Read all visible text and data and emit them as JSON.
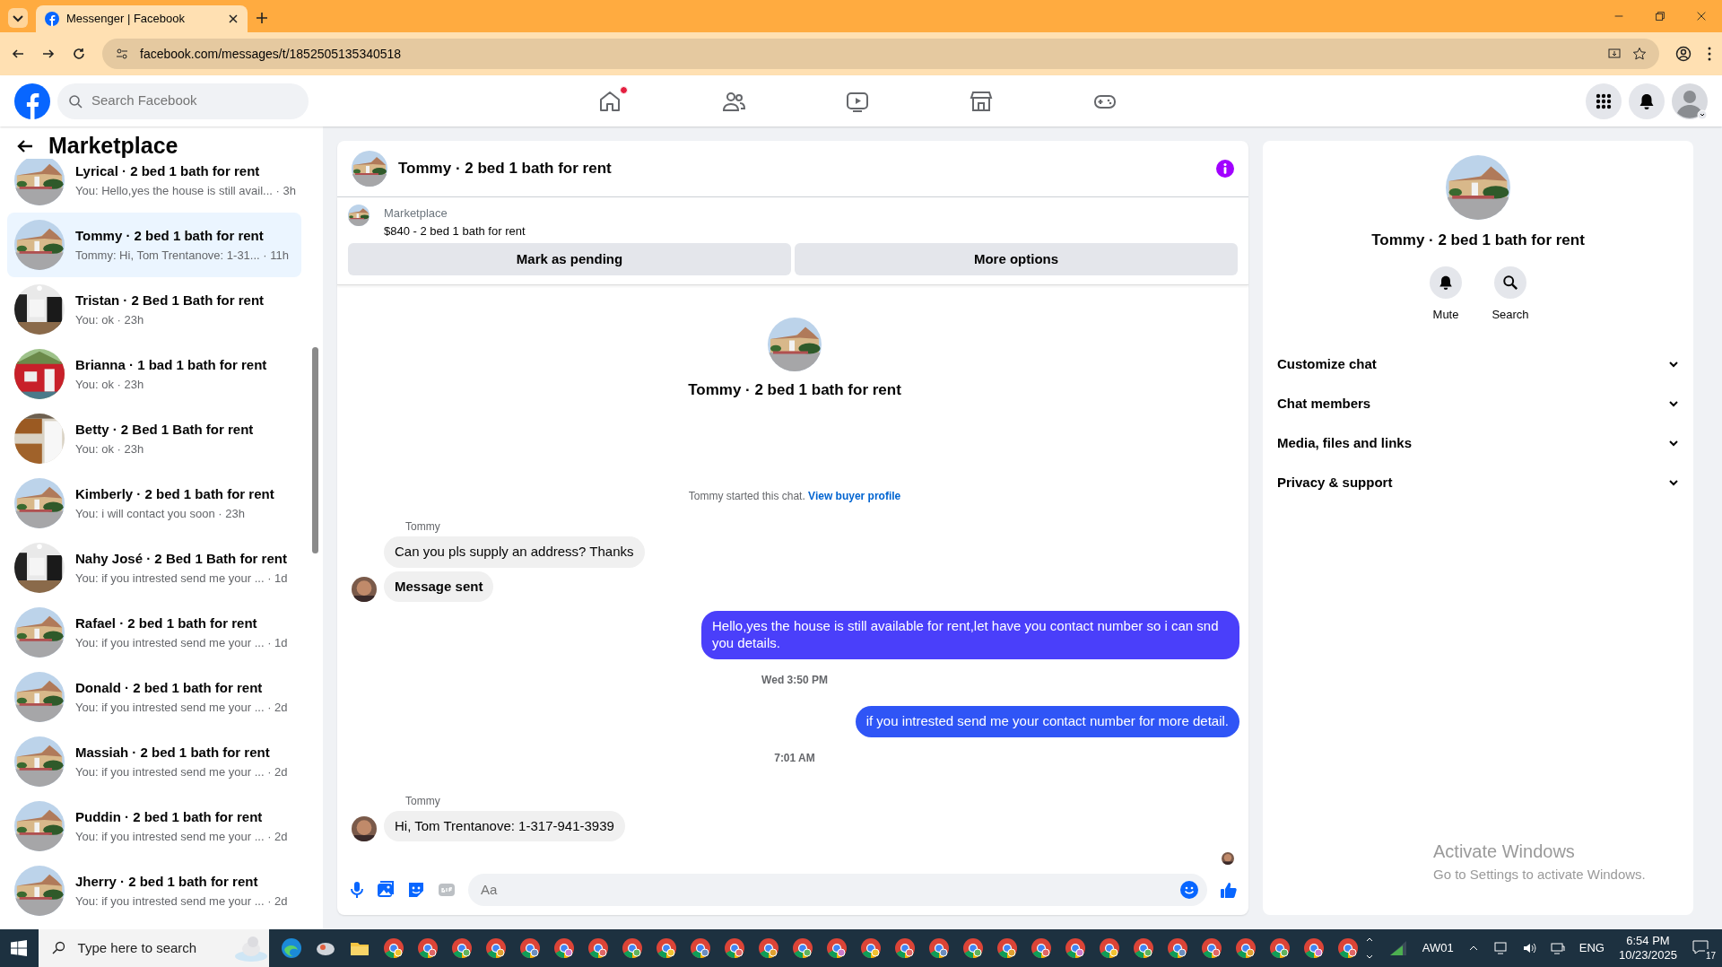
{
  "browser": {
    "tab_title": "Messenger | Facebook",
    "url": "facebook.com/messages/t/1852505135340518"
  },
  "facebook_header": {
    "search_placeholder": "Search Facebook",
    "home_notification": true
  },
  "sidebar": {
    "title": "Marketplace",
    "conversations": [
      {
        "name": "Lyrical · 2 bed 1 bath for rent",
        "preview": "You: Hello,yes the house is still avail... · 3h",
        "selected": false
      },
      {
        "name": "Tommy · 2 bed 1 bath for rent",
        "preview": "Tommy: Hi, Tom Trentanove: 1-31...  · 11h",
        "selected": true
      },
      {
        "name": "Tristan · 2 Bed 1 Bath for rent",
        "preview": "You: ok · 23h",
        "selected": false
      },
      {
        "name": "Brianna · 1 bad 1 bath for rent",
        "preview": "You: ok · 23h",
        "selected": false
      },
      {
        "name": "Betty · 2 Bed 1 Bath for rent",
        "preview": "You: ok · 23h",
        "selected": false
      },
      {
        "name": "Kimberly · 2 bed 1 bath for rent",
        "preview": "You: i will contact you soon · 23h",
        "selected": false
      },
      {
        "name": "Nahy José · 2 Bed 1 Bath for rent",
        "preview": "You: if you intrested send me your ... · 1d",
        "selected": false
      },
      {
        "name": "Rafael · 2 bed 1 bath for rent",
        "preview": "You: if you intrested send me your ... · 1d",
        "selected": false
      },
      {
        "name": "Donald · 2 bed 1 bath for rent",
        "preview": "You: if you intrested send me your ... · 2d",
        "selected": false
      },
      {
        "name": "Massiah · 2 bed 1 bath for rent",
        "preview": "You: if you intrested send me your ... · 2d",
        "selected": false
      },
      {
        "name": "Puddin · 2 bed 1 bath for rent",
        "preview": "You: if you intrested send me your ... · 2d",
        "selected": false
      },
      {
        "name": "Jherry · 2 bed 1 bath for rent",
        "preview": "You: if you intrested send me your ... · 2d",
        "selected": false
      }
    ]
  },
  "chat": {
    "title": "Tommy · 2 bed 1 bath for rent",
    "listing": {
      "label": "Marketplace",
      "title": "$840 - 2 bed 1 bath for rent"
    },
    "buttons": [
      "Mark as pending",
      "More options"
    ],
    "intro_name": "Tommy · 2 bed 1 bath for rent",
    "started_text": "Tommy started this chat.",
    "started_link": "View buyer profile",
    "messages": [
      {
        "kind": "sender",
        "text": "Tommy"
      },
      {
        "kind": "incoming",
        "text": "Can you pls supply an address? Thanks",
        "bold": false,
        "avatar": false
      },
      {
        "kind": "incoming",
        "text": "Message sent",
        "bold": true,
        "avatar": true
      },
      {
        "kind": "outgoing",
        "text": "Hello,yes the house is still available for rent,let have you contact number so i can snd you details.",
        "color": "#4a3ffa"
      },
      {
        "kind": "timestamp",
        "text": "Wed 3:50 PM"
      },
      {
        "kind": "outgoing",
        "text": "if you intrested send me your contact number for more detail.",
        "color": "#2f55f6"
      },
      {
        "kind": "timestamp",
        "text": "7:01 AM"
      },
      {
        "kind": "sender",
        "text": "Tommy"
      },
      {
        "kind": "incoming",
        "text": "Hi, Tom Trentanove: 1-317-941-3939",
        "bold": false,
        "avatar": true
      },
      {
        "kind": "seen"
      }
    ],
    "composer_placeholder": "Aa"
  },
  "details": {
    "name": "Tommy · 2 bed 1 bath for rent",
    "actions": [
      {
        "kind": "mute",
        "label": "Mute"
      },
      {
        "kind": "search",
        "label": "Search"
      }
    ],
    "sections": [
      {
        "label": "Customize chat",
        "expanded": false
      },
      {
        "label": "Chat members",
        "expanded": false
      },
      {
        "label": "Media, files and links",
        "expanded": false
      },
      {
        "label": "Privacy & support",
        "expanded": false
      }
    ]
  },
  "windows_notice": {
    "title": "Activate Windows",
    "subtitle": "Go to Settings to activate Windows."
  },
  "taskbar": {
    "search_placeholder": "Type here to search",
    "network": "AW01",
    "language": "ENG",
    "time": "6:54 PM",
    "date": "10/23/2025",
    "notifications": "17"
  }
}
